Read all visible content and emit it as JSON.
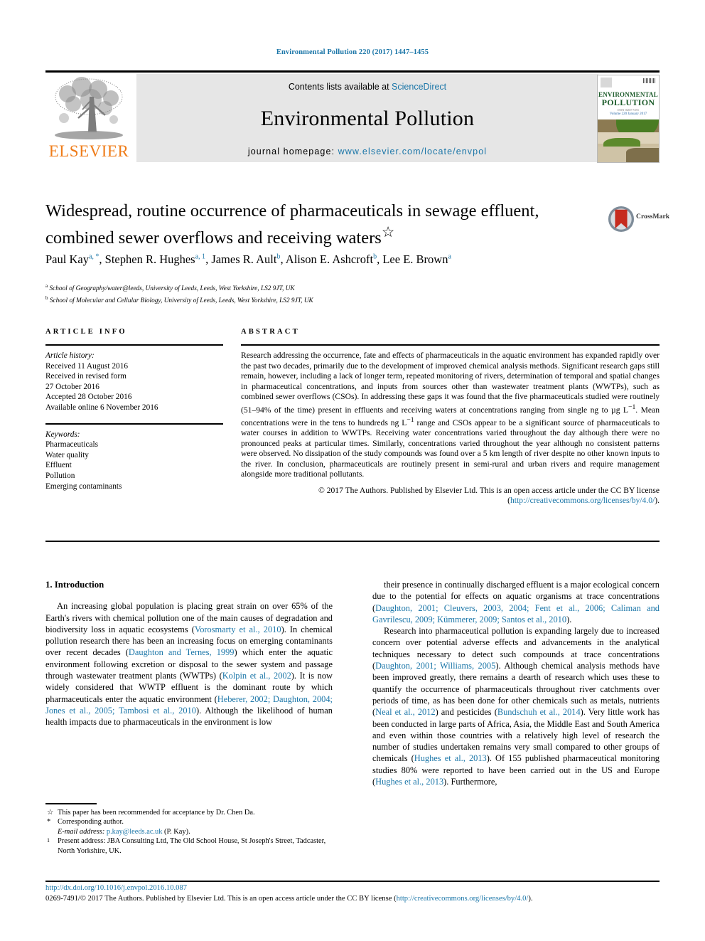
{
  "running_head": "Environmental Pollution 220 (2017) 1447–1455",
  "masthead": {
    "contents_prefix": "Contents lists available at ",
    "sciencedirect": "ScienceDirect",
    "journal_title": "Environmental Pollution",
    "homepage_prefix": "journal homepage: ",
    "homepage_url": "www.elsevier.com/locate/envpol",
    "publisher": "ELSEVIER",
    "cover": {
      "line1": "ENVIRONMENTAL",
      "line2": "POLLUTION",
      "line3": "ISSN 0269-7491",
      "line4": "Volume 220  January 2017"
    }
  },
  "article": {
    "title": "Widespread, routine occurrence of pharmaceuticals in sewage effluent, combined sewer overflows and receiving waters",
    "title_marker": "☆",
    "authors_raw": "Paul Kay a, *, Stephen R. Hughes a, 1, James R. Ault b, Alison E. Ashcroft b, Lee E. Brown a",
    "authors": [
      {
        "name": "Paul Kay",
        "sup": "a, *"
      },
      {
        "name": "Stephen R. Hughes",
        "sup": "a, 1"
      },
      {
        "name": "James R. Ault",
        "sup": "b"
      },
      {
        "name": "Alison E. Ashcroft",
        "sup": "b"
      },
      {
        "name": "Lee E. Brown",
        "sup": "a"
      }
    ],
    "affiliations": [
      {
        "mark": "a",
        "text": "School of Geography/water@leeds, University of Leeds, Leeds, West Yorkshire, LS2 9JT, UK"
      },
      {
        "mark": "b",
        "text": "School of Molecular and Cellular Biology, University of Leeds, Leeds, West Yorkshire, LS2 9JT, UK"
      }
    ],
    "crossmark_label": "CrossMark"
  },
  "article_info": {
    "heading": "ARTICLE INFO",
    "history_label": "Article history:",
    "history": [
      "Received 11 August 2016",
      "Received in revised form",
      "27 October 2016",
      "Accepted 28 October 2016",
      "Available online 6 November 2016"
    ],
    "keywords_label": "Keywords:",
    "keywords": [
      "Pharmaceuticals",
      "Water quality",
      "Effluent",
      "Pollution",
      "Emerging contaminants"
    ]
  },
  "abstract": {
    "heading": "ABSTRACT",
    "paragraph_parts": [
      "Research addressing the occurrence, fate and effects of pharmaceuticals in the aquatic environment has expanded rapidly over the past two decades, primarily due to the development of improved chemical analysis methods. Significant research gaps still remain, however, including a lack of longer term, repeated monitoring of rivers, determination of temporal and spatial changes in pharmaceutical concentrations, and inputs from sources other than wastewater treatment plants (WWTPs), such as combined sewer overflows (CSOs). In addressing these gaps it was found that the five pharmaceuticals studied were routinely (51–94% of the time) present in effluents and receiving waters at concentrations ranging from single ng to µg L",
      ". Mean concentrations were in the tens to hundreds ng L",
      " range and CSOs appear to be a significant source of pharmaceuticals to water courses in addition to WWTPs. Receiving water concentrations varied throughout the day although there were no pronounced peaks at particular times. Similarly, concentrations varied throughout the year although no consistent patterns were observed. No dissipation of the study compounds was found over a 5 km length of river despite no other known inputs to the river. In conclusion, pharmaceuticals are routinely present in semi-rural and urban rivers and require management alongside more traditional pollutants."
    ],
    "superscript": "−1",
    "copyright_text": "© 2017 The Authors. Published by Elsevier Ltd. This is an open access article under the CC BY license",
    "license_open": "(",
    "license_url": "http://creativecommons.org/licenses/by/4.0/",
    "license_close": ")."
  },
  "intro": {
    "heading": "1. Introduction",
    "left_paragraph_parts": [
      "An increasing global population is placing great strain on over 65% of the Earth's rivers with chemical pollution one of the main causes of degradation and biodiversity loss in aquatic ecosystems (",
      "Vorosmarty et al., 2010",
      "). In chemical pollution research there has been an increasing focus on emerging contaminants over recent decades (",
      "Daughton and Ternes, 1999",
      ") which enter the aquatic environment following excretion or disposal to the sewer system and passage through wastewater treatment plants (WWTPs) (",
      "Kolpin et al., 2002",
      "). It is now widely considered that WWTP effluent is the dominant route by which pharmaceuticals enter the aquatic environment (",
      "Heberer, 2002; Daughton, 2004; Jones et al., 2005; Tambosi et al., 2010",
      "). Although the likelihood of human health impacts due to pharmaceuticals in the environment is low"
    ],
    "right_paragraph1_parts": [
      "their presence in continually discharged effluent is a major ecological concern due to the potential for effects on aquatic organisms at trace concentrations (",
      "Daughton, 2001; Cleuvers, 2003, 2004; Fent et al., 2006; Caliman and Gavrilescu, 2009; Kümmerer, 2009; Santos et al., 2010",
      ")."
    ],
    "right_paragraph2_parts": [
      "Research into pharmaceutical pollution is expanding largely due to increased concern over potential adverse effects and advancements in the analytical techniques necessary to detect such compounds at trace concentrations (",
      "Daughton, 2001; Williams, 2005",
      "). Although chemical analysis methods have been improved greatly, there remains a dearth of research which uses these to quantify the occurrence of pharmaceuticals throughout river catchments over periods of time, as has been done for other chemicals such as metals, nutrients (",
      "Neal et al., 2012",
      ") and pesticides (",
      "Bundschuh et al., 2014",
      "). Very little work has been conducted in large parts of Africa, Asia, the Middle East and South America and even within those countries with a relatively high level of research the number of studies undertaken remains very small compared to other groups of chemicals (",
      "Hughes et al., 2013",
      "). Of 155 published pharmaceutical monitoring studies 80% were reported to have been carried out in the US and Europe (",
      "Hughes et al., 2013",
      "). Furthermore,"
    ]
  },
  "footnotes": [
    {
      "mark": "☆",
      "text": "This paper has been recommended for acceptance by Dr. Chen Da."
    },
    {
      "mark": "*",
      "text": "Corresponding author."
    },
    {
      "mark": "",
      "label": "E-mail address:",
      "email": "p.kay@leeds.ac.uk",
      "suffix": " (P. Kay)."
    },
    {
      "mark": "1",
      "text": "Present address: JBA Consulting Ltd, The Old School House, St Joseph's Street, Tadcaster, North Yorkshire, UK."
    }
  ],
  "footer": {
    "doi": "http://dx.doi.org/10.1016/j.envpol.2016.10.087",
    "issn_copy": "0269-7491/© 2017 The Authors. Published by Elsevier Ltd. This is an open access article under the CC BY license (",
    "license_url": "http://creativecommons.org/licenses/by/4.0/",
    "issn_copy_end": ")."
  },
  "colors": {
    "link": "#1b76a8",
    "elsevier_orange": "#ef7c19",
    "masthead_bg": "#e6e6e6"
  }
}
